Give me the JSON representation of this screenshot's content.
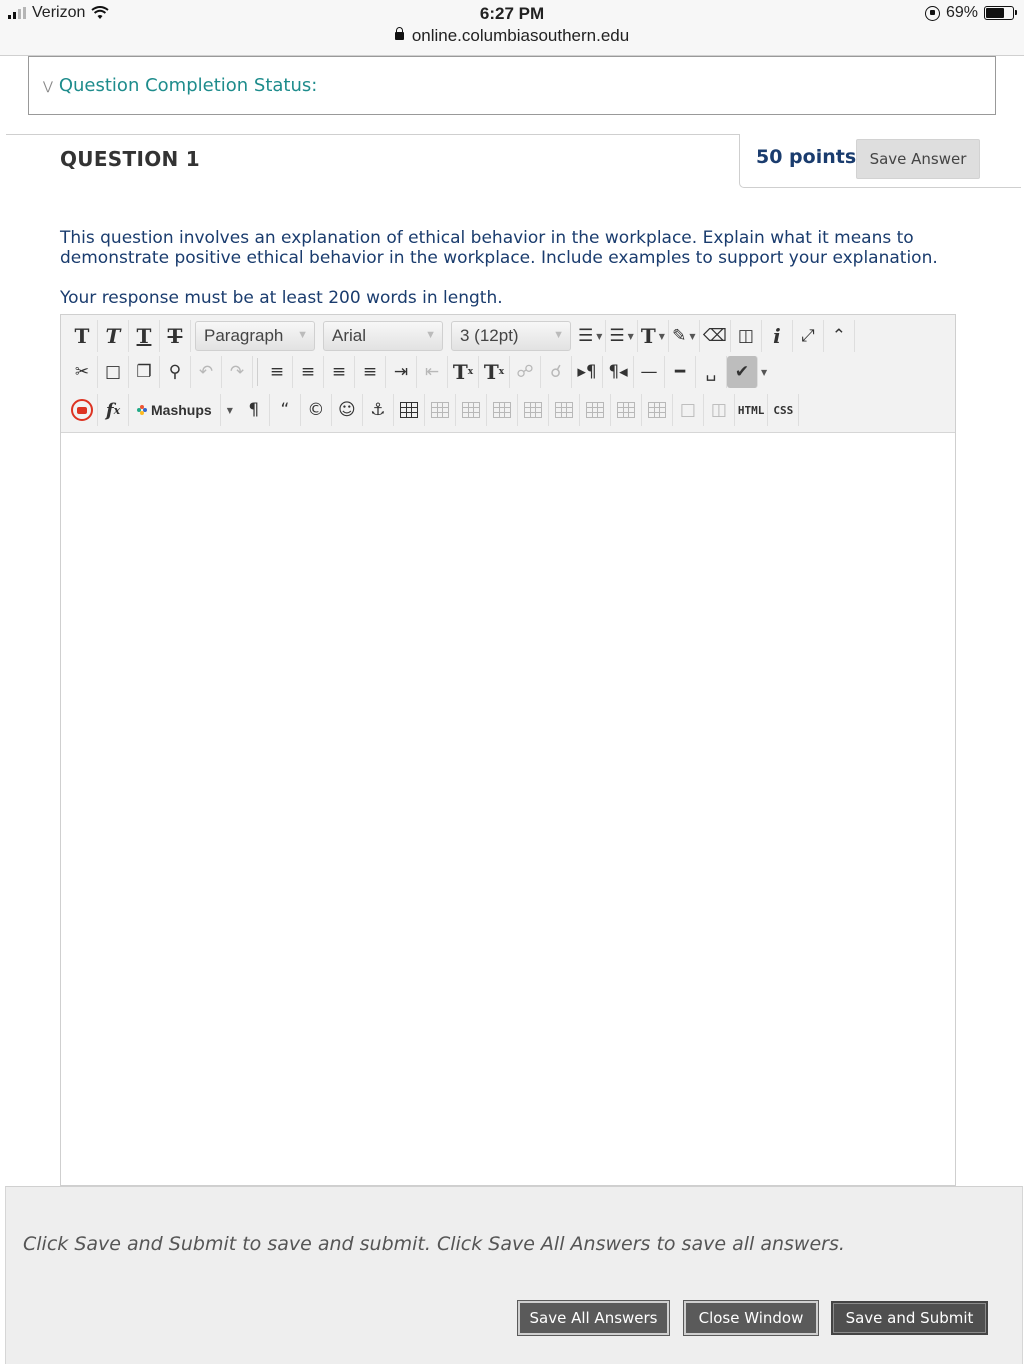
{
  "status_bar": {
    "carrier": "Verizon",
    "time": "6:27 PM",
    "url": "online.columbiasouthern.edu",
    "battery_percent": "69%",
    "battery_level": 0.69
  },
  "completion": {
    "label": "Question Completion Status:"
  },
  "question": {
    "title": "QUESTION 1",
    "points": "50 points",
    "save_answer_label": "Save Answer",
    "text_line1": "This question involves an explanation of ethical behavior in the workplace. Explain what it means to",
    "text_line2": "demonstrate positive ethical behavior in the workplace. Include examples to support your explanation.",
    "text_requirement": "Your response must be at least 200 words in length."
  },
  "editor": {
    "paragraph_format": "Paragraph",
    "font_family": "Arial",
    "font_size": "3 (12pt)",
    "mashups_label": "Mashups",
    "html_label": "HTML",
    "css_label": "CSS",
    "content": ""
  },
  "footer": {
    "message": "Click Save and Submit to save and submit. Click Save All Answers to save all answers.",
    "save_all_label": "Save All Answers",
    "close_window_label": "Close Window",
    "save_submit_label": "Save and Submit"
  },
  "colors": {
    "link_teal": "#1e8c8c",
    "text_navy": "#1a3c6e",
    "button_dark": "#5a5a5a"
  }
}
